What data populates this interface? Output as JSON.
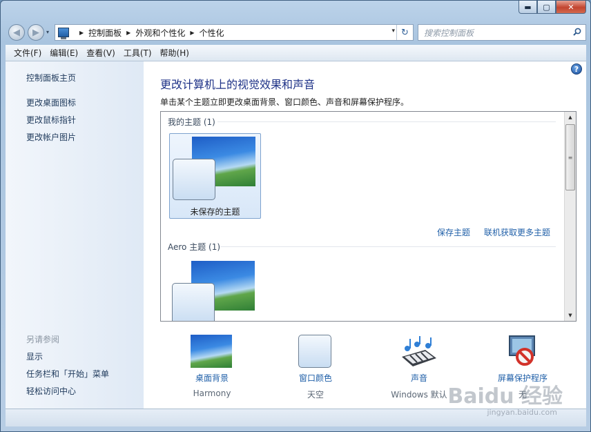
{
  "window": {
    "minimize": "▬",
    "maximize": "▢",
    "close": "✕"
  },
  "nav": {
    "back": "◀",
    "forward": "▶",
    "dropdown": "▾"
  },
  "address": {
    "separator": "▶",
    "crumbs": [
      "控制面板",
      "外观和个性化",
      "个性化"
    ],
    "dropdown": "▾",
    "refresh": "↻"
  },
  "search": {
    "placeholder": "搜索控制面板"
  },
  "menu": [
    "文件(F)",
    "编辑(E)",
    "查看(V)",
    "工具(T)",
    "帮助(H)"
  ],
  "sidebar": {
    "home": "控制面板主页",
    "links": [
      "更改桌面图标",
      "更改鼠标指针",
      "更改帐户图片"
    ],
    "see_also_header": "另请参阅",
    "see_also": [
      "显示",
      "任务栏和「开始」菜单",
      "轻松访问中心"
    ]
  },
  "help": "?",
  "main": {
    "title": "更改计算机上的视觉效果和声音",
    "description": "单击某个主题立即更改桌面背景、窗口颜色、声音和屏幕保护程序。"
  },
  "themes": {
    "my_group": "我的主题 (1)",
    "unsaved_label": "未保存的主题",
    "save_link": "保存主题",
    "online_link": "联机获取更多主题",
    "aero_group": "Aero 主题 (1)"
  },
  "scroll": {
    "up": "▲",
    "down": "▼",
    "grip": "≡"
  },
  "bottom": [
    {
      "label": "桌面背景",
      "sub": "Harmony"
    },
    {
      "label": "窗口颜色",
      "sub": "天空"
    },
    {
      "label": "声音",
      "sub": "Windows 默认"
    },
    {
      "label": "屏幕保护程序",
      "sub": "无"
    }
  ],
  "watermark": {
    "text": "Baidu 经验",
    "url": "jingyan.baidu.com"
  }
}
